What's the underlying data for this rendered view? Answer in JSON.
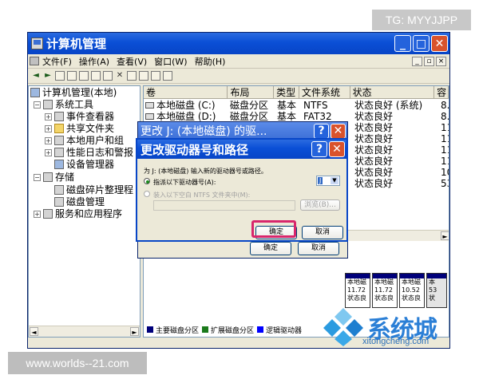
{
  "watermark": {
    "top": "TG: MYYJJPP",
    "bottom": "www.worlds--21.com"
  },
  "window": {
    "title": "计算机管理"
  },
  "menu": {
    "items": [
      "文件(F)",
      "操作(A)",
      "查看(V)",
      "窗口(W)",
      "帮助(H)"
    ]
  },
  "tree": {
    "root": "计算机管理(本地)",
    "system_tools": "系统工具",
    "event_viewer": "事件查看器",
    "shared_folders": "共享文件夹",
    "local_users": "本地用户和组",
    "perf_logs": "性能日志和警报",
    "device_manager": "设备管理器",
    "storage": "存储",
    "defrag": "磁盘碎片整理程",
    "disk_mgmt": "磁盘管理",
    "services": "服务和应用程序"
  },
  "volume_list": {
    "columns": [
      "卷",
      "布局",
      "类型",
      "文件系统",
      "状态",
      "容"
    ],
    "rows": [
      {
        "volume": "本地磁盘 (C:)",
        "layout": "磁盘分区",
        "type": "基本",
        "fs": "NTFS",
        "status": "状态良好 (系统)",
        "cap": "8."
      },
      {
        "volume": "本地磁盘 (D:)",
        "layout": "磁盘分区",
        "type": "基本",
        "fs": "FAT32",
        "status": "状态良好",
        "cap": "8."
      },
      {
        "volume": "",
        "layout": "",
        "type": "",
        "fs": "",
        "status": "状态良好",
        "cap": "11"
      },
      {
        "volume": "",
        "layout": "",
        "type": "",
        "fs": "",
        "status": "状态良好",
        "cap": "11"
      },
      {
        "volume": "",
        "layout": "",
        "type": "",
        "fs": "",
        "status": "状态良好",
        "cap": "11"
      },
      {
        "volume": "",
        "layout": "",
        "type": "",
        "fs": "",
        "status": "状态良好",
        "cap": "11"
      },
      {
        "volume": "",
        "layout": "",
        "type": "",
        "fs": "",
        "status": "状态良好",
        "cap": "10"
      },
      {
        "volume": "",
        "layout": "",
        "type": "",
        "fs": "",
        "status": "状态良好",
        "cap": "53"
      }
    ]
  },
  "disk_graph": {
    "cells": [
      {
        "name": "本地磁",
        "size": "11.72",
        "status": "状态良"
      },
      {
        "name": "本地磁",
        "size": "11.72",
        "status": "状态良"
      },
      {
        "name": "本地磁",
        "size": "10.52",
        "status": "状态良"
      },
      {
        "name": "本",
        "size": "53",
        "status": "状"
      }
    ],
    "legend": [
      {
        "label": "主要磁盘分区",
        "color": "#00007a"
      },
      {
        "label": "扩展磁盘分区",
        "color": "#1b7a1b"
      },
      {
        "label": "逻辑驱动器",
        "color": "#0000ff"
      }
    ]
  },
  "back_dialog": {
    "title": "更改 J: (本地磁盘) 的驱...",
    "ok": "确定",
    "cancel": "取消"
  },
  "dialog": {
    "title": "更改驱动器号和路径",
    "description": "为 J: (本地磁盘) 输入新的驱动器号或路径。",
    "assign_letter": "指派以下驱动器号(A):",
    "drive_letter": "J",
    "mount_path": "装入以下空白 NTFS 文件夹中(M):",
    "browse": "浏览(B)...",
    "ok": "确定",
    "cancel": "取消"
  },
  "logo": {
    "word": "系统城",
    "url": "xitongcheng.com"
  },
  "colors": {
    "accent": "#0a4fd6",
    "highlight": "#d8266c"
  }
}
